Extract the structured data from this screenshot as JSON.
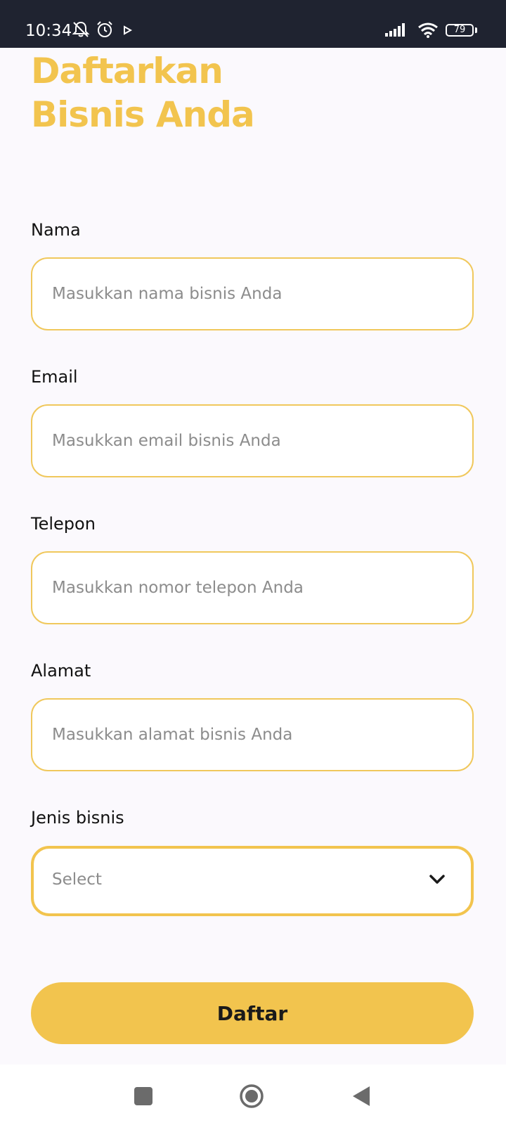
{
  "status_bar": {
    "time": "10:34",
    "battery_level": "79",
    "icons": [
      "mute-bell-icon",
      "alarm-icon",
      "play-icon",
      "signal-icon",
      "wifi-icon",
      "battery-icon"
    ]
  },
  "page": {
    "title_line1": "Daftarkan",
    "title_line2": "Bisnis Anda"
  },
  "form": {
    "nama": {
      "label": "Nama",
      "placeholder": "Masukkan nama bisnis Anda",
      "value": ""
    },
    "email": {
      "label": "Email",
      "placeholder": "Masukkan email bisnis Anda",
      "value": ""
    },
    "telepon": {
      "label": "Telepon",
      "placeholder": "Masukkan nomor telepon Anda",
      "value": ""
    },
    "alamat": {
      "label": "Alamat",
      "placeholder": "Masukkan alamat bisnis Anda",
      "value": ""
    },
    "jenis_bisnis": {
      "label": "Jenis bisnis",
      "selected": "Select"
    },
    "submit_label": "Daftar"
  },
  "nav_bar": {
    "icons": [
      "recents-square-icon",
      "home-circle-icon",
      "back-triangle-icon"
    ]
  },
  "colors": {
    "accent": "#f2c44e",
    "background": "#fbf9fd",
    "status_bar": "#1f2330"
  }
}
